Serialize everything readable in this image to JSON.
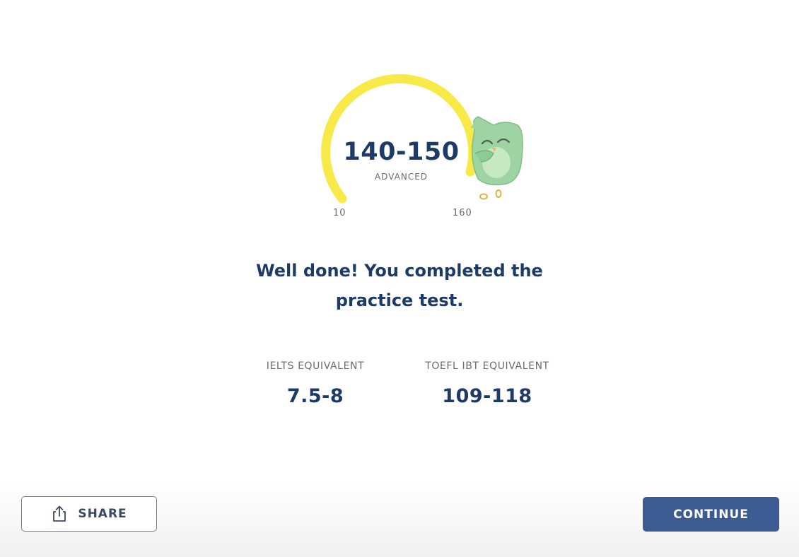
{
  "result": {
    "score_range": "140-150",
    "level": "ADVANCED",
    "gauge": {
      "min_label": "10",
      "max_label": "160",
      "min": 10,
      "max": 160,
      "score_low": 140,
      "score_high": 150
    }
  },
  "message": {
    "line1": "Well done! You completed the",
    "line2": "practice test."
  },
  "equivalents": {
    "ielts": {
      "label": "IELTS EQUIVALENT",
      "value": "7.5-8"
    },
    "toefl": {
      "label": "TOEFL IBT EQUIVALENT",
      "value": "109-118"
    }
  },
  "actions": {
    "share_label": "SHARE",
    "continue_label": "CONTINUE"
  },
  "icons": {
    "share": "share-icon",
    "mascot": "owl-mascot"
  },
  "colors": {
    "gauge_fill": "#f7ea48",
    "text_primary": "#1e3a66",
    "text_secondary": "#6b6b6b",
    "continue_button": "#3b5b92",
    "mascot_body": "#9ed3a3"
  }
}
